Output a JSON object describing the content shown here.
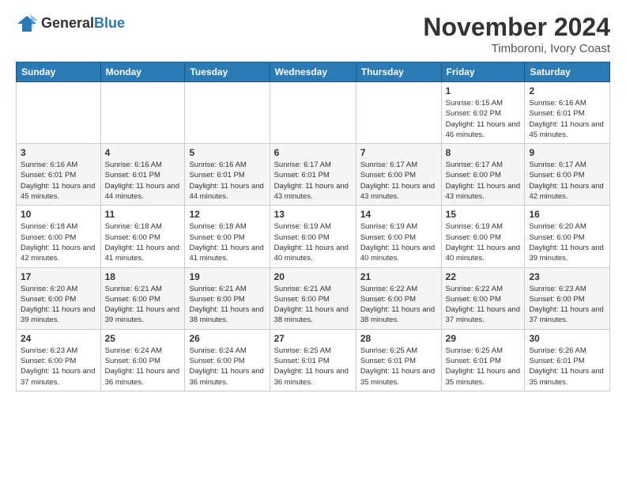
{
  "logo": {
    "general": "General",
    "blue": "Blue"
  },
  "header": {
    "month": "November 2024",
    "location": "Timboroni, Ivory Coast"
  },
  "weekdays": [
    "Sunday",
    "Monday",
    "Tuesday",
    "Wednesday",
    "Thursday",
    "Friday",
    "Saturday"
  ],
  "weeks": [
    [
      {
        "day": "",
        "sunrise": "",
        "sunset": "",
        "daylight": ""
      },
      {
        "day": "",
        "sunrise": "",
        "sunset": "",
        "daylight": ""
      },
      {
        "day": "",
        "sunrise": "",
        "sunset": "",
        "daylight": ""
      },
      {
        "day": "",
        "sunrise": "",
        "sunset": "",
        "daylight": ""
      },
      {
        "day": "",
        "sunrise": "",
        "sunset": "",
        "daylight": ""
      },
      {
        "day": "1",
        "sunrise": "Sunrise: 6:15 AM",
        "sunset": "Sunset: 6:02 PM",
        "daylight": "Daylight: 11 hours and 46 minutes."
      },
      {
        "day": "2",
        "sunrise": "Sunrise: 6:16 AM",
        "sunset": "Sunset: 6:01 PM",
        "daylight": "Daylight: 11 hours and 45 minutes."
      }
    ],
    [
      {
        "day": "3",
        "sunrise": "Sunrise: 6:16 AM",
        "sunset": "Sunset: 6:01 PM",
        "daylight": "Daylight: 11 hours and 45 minutes."
      },
      {
        "day": "4",
        "sunrise": "Sunrise: 6:16 AM",
        "sunset": "Sunset: 6:01 PM",
        "daylight": "Daylight: 11 hours and 44 minutes."
      },
      {
        "day": "5",
        "sunrise": "Sunrise: 6:16 AM",
        "sunset": "Sunset: 6:01 PM",
        "daylight": "Daylight: 11 hours and 44 minutes."
      },
      {
        "day": "6",
        "sunrise": "Sunrise: 6:17 AM",
        "sunset": "Sunset: 6:01 PM",
        "daylight": "Daylight: 11 hours and 43 minutes."
      },
      {
        "day": "7",
        "sunrise": "Sunrise: 6:17 AM",
        "sunset": "Sunset: 6:00 PM",
        "daylight": "Daylight: 11 hours and 43 minutes."
      },
      {
        "day": "8",
        "sunrise": "Sunrise: 6:17 AM",
        "sunset": "Sunset: 6:00 PM",
        "daylight": "Daylight: 11 hours and 43 minutes."
      },
      {
        "day": "9",
        "sunrise": "Sunrise: 6:17 AM",
        "sunset": "Sunset: 6:00 PM",
        "daylight": "Daylight: 11 hours and 42 minutes."
      }
    ],
    [
      {
        "day": "10",
        "sunrise": "Sunrise: 6:18 AM",
        "sunset": "Sunset: 6:00 PM",
        "daylight": "Daylight: 11 hours and 42 minutes."
      },
      {
        "day": "11",
        "sunrise": "Sunrise: 6:18 AM",
        "sunset": "Sunset: 6:00 PM",
        "daylight": "Daylight: 11 hours and 41 minutes."
      },
      {
        "day": "12",
        "sunrise": "Sunrise: 6:18 AM",
        "sunset": "Sunset: 6:00 PM",
        "daylight": "Daylight: 11 hours and 41 minutes."
      },
      {
        "day": "13",
        "sunrise": "Sunrise: 6:19 AM",
        "sunset": "Sunset: 6:00 PM",
        "daylight": "Daylight: 11 hours and 40 minutes."
      },
      {
        "day": "14",
        "sunrise": "Sunrise: 6:19 AM",
        "sunset": "Sunset: 6:00 PM",
        "daylight": "Daylight: 11 hours and 40 minutes."
      },
      {
        "day": "15",
        "sunrise": "Sunrise: 6:19 AM",
        "sunset": "Sunset: 6:00 PM",
        "daylight": "Daylight: 11 hours and 40 minutes."
      },
      {
        "day": "16",
        "sunrise": "Sunrise: 6:20 AM",
        "sunset": "Sunset: 6:00 PM",
        "daylight": "Daylight: 11 hours and 39 minutes."
      }
    ],
    [
      {
        "day": "17",
        "sunrise": "Sunrise: 6:20 AM",
        "sunset": "Sunset: 6:00 PM",
        "daylight": "Daylight: 11 hours and 39 minutes."
      },
      {
        "day": "18",
        "sunrise": "Sunrise: 6:21 AM",
        "sunset": "Sunset: 6:00 PM",
        "daylight": "Daylight: 11 hours and 39 minutes."
      },
      {
        "day": "19",
        "sunrise": "Sunrise: 6:21 AM",
        "sunset": "Sunset: 6:00 PM",
        "daylight": "Daylight: 11 hours and 38 minutes."
      },
      {
        "day": "20",
        "sunrise": "Sunrise: 6:21 AM",
        "sunset": "Sunset: 6:00 PM",
        "daylight": "Daylight: 11 hours and 38 minutes."
      },
      {
        "day": "21",
        "sunrise": "Sunrise: 6:22 AM",
        "sunset": "Sunset: 6:00 PM",
        "daylight": "Daylight: 11 hours and 38 minutes."
      },
      {
        "day": "22",
        "sunrise": "Sunrise: 6:22 AM",
        "sunset": "Sunset: 6:00 PM",
        "daylight": "Daylight: 11 hours and 37 minutes."
      },
      {
        "day": "23",
        "sunrise": "Sunrise: 6:23 AM",
        "sunset": "Sunset: 6:00 PM",
        "daylight": "Daylight: 11 hours and 37 minutes."
      }
    ],
    [
      {
        "day": "24",
        "sunrise": "Sunrise: 6:23 AM",
        "sunset": "Sunset: 6:00 PM",
        "daylight": "Daylight: 11 hours and 37 minutes."
      },
      {
        "day": "25",
        "sunrise": "Sunrise: 6:24 AM",
        "sunset": "Sunset: 6:00 PM",
        "daylight": "Daylight: 11 hours and 36 minutes."
      },
      {
        "day": "26",
        "sunrise": "Sunrise: 6:24 AM",
        "sunset": "Sunset: 6:00 PM",
        "daylight": "Daylight: 11 hours and 36 minutes."
      },
      {
        "day": "27",
        "sunrise": "Sunrise: 6:25 AM",
        "sunset": "Sunset: 6:01 PM",
        "daylight": "Daylight: 11 hours and 36 minutes."
      },
      {
        "day": "28",
        "sunrise": "Sunrise: 6:25 AM",
        "sunset": "Sunset: 6:01 PM",
        "daylight": "Daylight: 11 hours and 35 minutes."
      },
      {
        "day": "29",
        "sunrise": "Sunrise: 6:25 AM",
        "sunset": "Sunset: 6:01 PM",
        "daylight": "Daylight: 11 hours and 35 minutes."
      },
      {
        "day": "30",
        "sunrise": "Sunrise: 6:26 AM",
        "sunset": "Sunset: 6:01 PM",
        "daylight": "Daylight: 11 hours and 35 minutes."
      }
    ]
  ]
}
